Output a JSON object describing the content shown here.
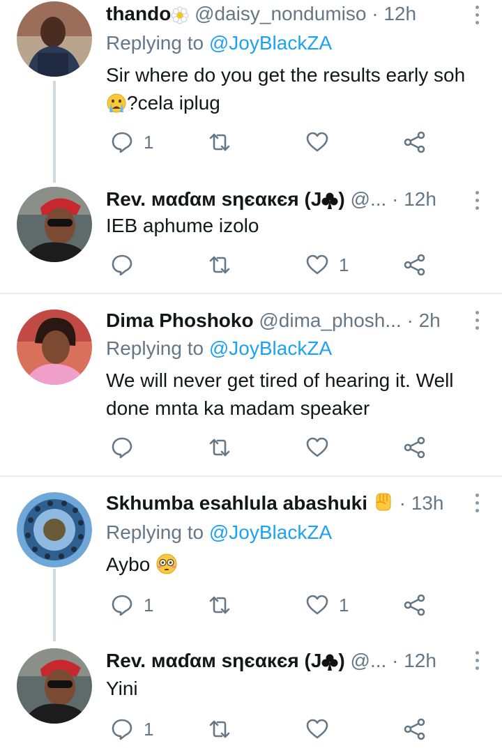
{
  "colors": {
    "accent": "#1da1f2",
    "secondary": "#657786",
    "line": "#cfd9de",
    "divider": "#e6ecf0"
  },
  "tweets": [
    {
      "name": "thando",
      "name_emoji": "daisy-icon",
      "handle": "@daisy_nondumiso",
      "dot": "·",
      "time": "12h",
      "replying_label": "Replying to",
      "replying_to": "@JoyBlackZA",
      "text_line1": "Sir where do you get the results early soh",
      "text_line2": "?cela iplug",
      "text_emoji": "crying-face-icon",
      "reply_count": "1",
      "retweet_count": "",
      "like_count": ""
    },
    {
      "name": "Rev. мαɗαм ѕηєαкєя (J",
      "name_suffix": ")",
      "name_emoji": "club-suit-icon",
      "handle": "@...",
      "dot": "·",
      "time": "12h",
      "text_line1": "IEB aphume izolo",
      "reply_count": "",
      "retweet_count": "",
      "like_count": "1"
    },
    {
      "name": "Dima Phoshoko",
      "handle": "@dima_phosh...",
      "dot": "·",
      "time": "2h",
      "replying_label": "Replying to",
      "replying_to": "@JoyBlackZA",
      "text_line1": "We will never get tired of hearing it. Well",
      "text_line2": "done mnta ka madam speaker",
      "reply_count": "",
      "retweet_count": "",
      "like_count": ""
    },
    {
      "name": "Skhumba esahlula abashuki",
      "name_emoji": "raised-fist-icon",
      "handle": "",
      "dot": "·",
      "time": "13h",
      "replying_label": "Replying to",
      "replying_to": "@JoyBlackZA",
      "text_line1": "Aybo",
      "text_emoji": "flushed-face-icon",
      "reply_count": "1",
      "retweet_count": "",
      "like_count": "1"
    },
    {
      "name": "Rev. мαɗαм ѕηєαкєя (J",
      "name_suffix": ")",
      "name_emoji": "club-suit-icon",
      "handle": "@...",
      "dot": "·",
      "time": "12h",
      "text_line1": "Yini",
      "reply_count": "1",
      "retweet_count": "",
      "like_count": ""
    }
  ]
}
